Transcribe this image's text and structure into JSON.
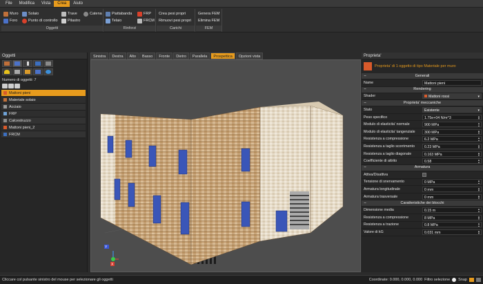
{
  "menu": [
    "File",
    "Modifica",
    "Vista",
    "Crea",
    "Aiuto"
  ],
  "menu_active_index": 3,
  "ribbon": {
    "oggetti": {
      "title": "Oggetti",
      "buttons": [
        "Muro",
        "Solaio",
        "Trave",
        "Catena",
        "Foro",
        "Punto di controllo",
        "Pilastro"
      ]
    },
    "rinforzi": {
      "title": "Rinforzi",
      "buttons": [
        "Piattabanda",
        "FRP",
        "Telaio",
        "FRCM"
      ]
    },
    "carichi": {
      "title": "Carichi",
      "buttons": [
        "Crea pesi propri",
        "Rimuovi pesi propri"
      ]
    },
    "fem": {
      "title": "FEM",
      "buttons": [
        "Genera FEM",
        "Elimina FEM"
      ]
    }
  },
  "left_panel": {
    "title": "Oggetti",
    "count_label": "Numero di oggetti: 7",
    "objects": [
      {
        "name": "Mattoni pieni",
        "color": "#d95a2b",
        "selected": true
      },
      {
        "name": "Materiale solaio",
        "color": "#c0703a",
        "selected": false
      },
      {
        "name": "Acciaio",
        "color": "#9a9a9a",
        "selected": false
      },
      {
        "name": "FRP",
        "color": "#6fa3d8",
        "selected": false
      },
      {
        "name": "Calcestruzzo",
        "color": "#8c8c8c",
        "selected": false
      },
      {
        "name": "Mattoni pieni_2",
        "color": "#d95a2b",
        "selected": false
      },
      {
        "name": "FRCM",
        "color": "#3c6fbf",
        "selected": false
      }
    ]
  },
  "view_tabs": [
    "Sinistra",
    "Destra",
    "Alto",
    "Basso",
    "Fronte",
    "Dietro",
    "Parallela",
    "Prospettica",
    "Opzioni vista"
  ],
  "view_tab_active_index": 7,
  "properties": {
    "title": "Proprieta'",
    "header": "Proprieta' di 1 oggetto di tipo Materiale per muro",
    "generali": {
      "section": "Generali",
      "name_label": "Name",
      "name_value": "Mattoni pieni"
    },
    "rendering": {
      "section": "Rendering",
      "shader_label": "Shader",
      "shader_value": "Mattoni rossi"
    },
    "meccaniche": {
      "section": "Proprieta' meccaniche",
      "rows": [
        {
          "label": "Stato",
          "value": "Esistente",
          "kind": "dropdown"
        },
        {
          "label": "Peso specifico",
          "value": "1.75e+04 N/m^3",
          "kind": "spin"
        },
        {
          "label": "Modulo di elasticita' normale",
          "value": "900 MPa",
          "kind": "spin"
        },
        {
          "label": "Modulo di elasticita' tangenziale",
          "value": "300 MPa",
          "kind": "spin"
        },
        {
          "label": "Resistenza a compressione",
          "value": "6.2 MPa",
          "kind": "spin"
        },
        {
          "label": "Resistenza a taglio scorrimento",
          "value": "0.23 MPa",
          "kind": "spin"
        },
        {
          "label": "Resistenza a taglio diagonale",
          "value": "0.163 MPa",
          "kind": "spin"
        },
        {
          "label": "Coefficiente di attrito",
          "value": "0.58",
          "kind": "spin"
        }
      ]
    },
    "armatura": {
      "section": "Armatura",
      "active_label": "Attiva/Disattiva",
      "rows": [
        {
          "label": "Tensione di snervamento",
          "value": "0 MPa"
        },
        {
          "label": "Armatura longitudinale",
          "value": "0 mm"
        },
        {
          "label": "Armatura trasversale",
          "value": "0 mm"
        }
      ]
    },
    "blocchi": {
      "section": "Caratteristiche dei blocchi",
      "rows": [
        {
          "label": "Dimensione media",
          "value": "0.15 m"
        },
        {
          "label": "Resistenza a compressione",
          "value": "8 MPa"
        },
        {
          "label": "Resistenza a trazione",
          "value": "0.8 MPa"
        },
        {
          "label": "Valore di kG",
          "value": "0.031 mm"
        }
      ]
    }
  },
  "axes": {
    "y": "Y",
    "x": "X",
    "z": "Z"
  },
  "status": {
    "message": "Cliccare col pulsante sinistro del mouse per selezionare gli oggetti",
    "coordinates": "Coordinate: 0.000, 0.000, 0.000",
    "filter": "Filtro selezione",
    "snap": "Snap"
  },
  "colors": {
    "accent": "#e79b1d",
    "brick": "#c9a57c",
    "window": "#3a56b8",
    "panel": "#262626"
  }
}
